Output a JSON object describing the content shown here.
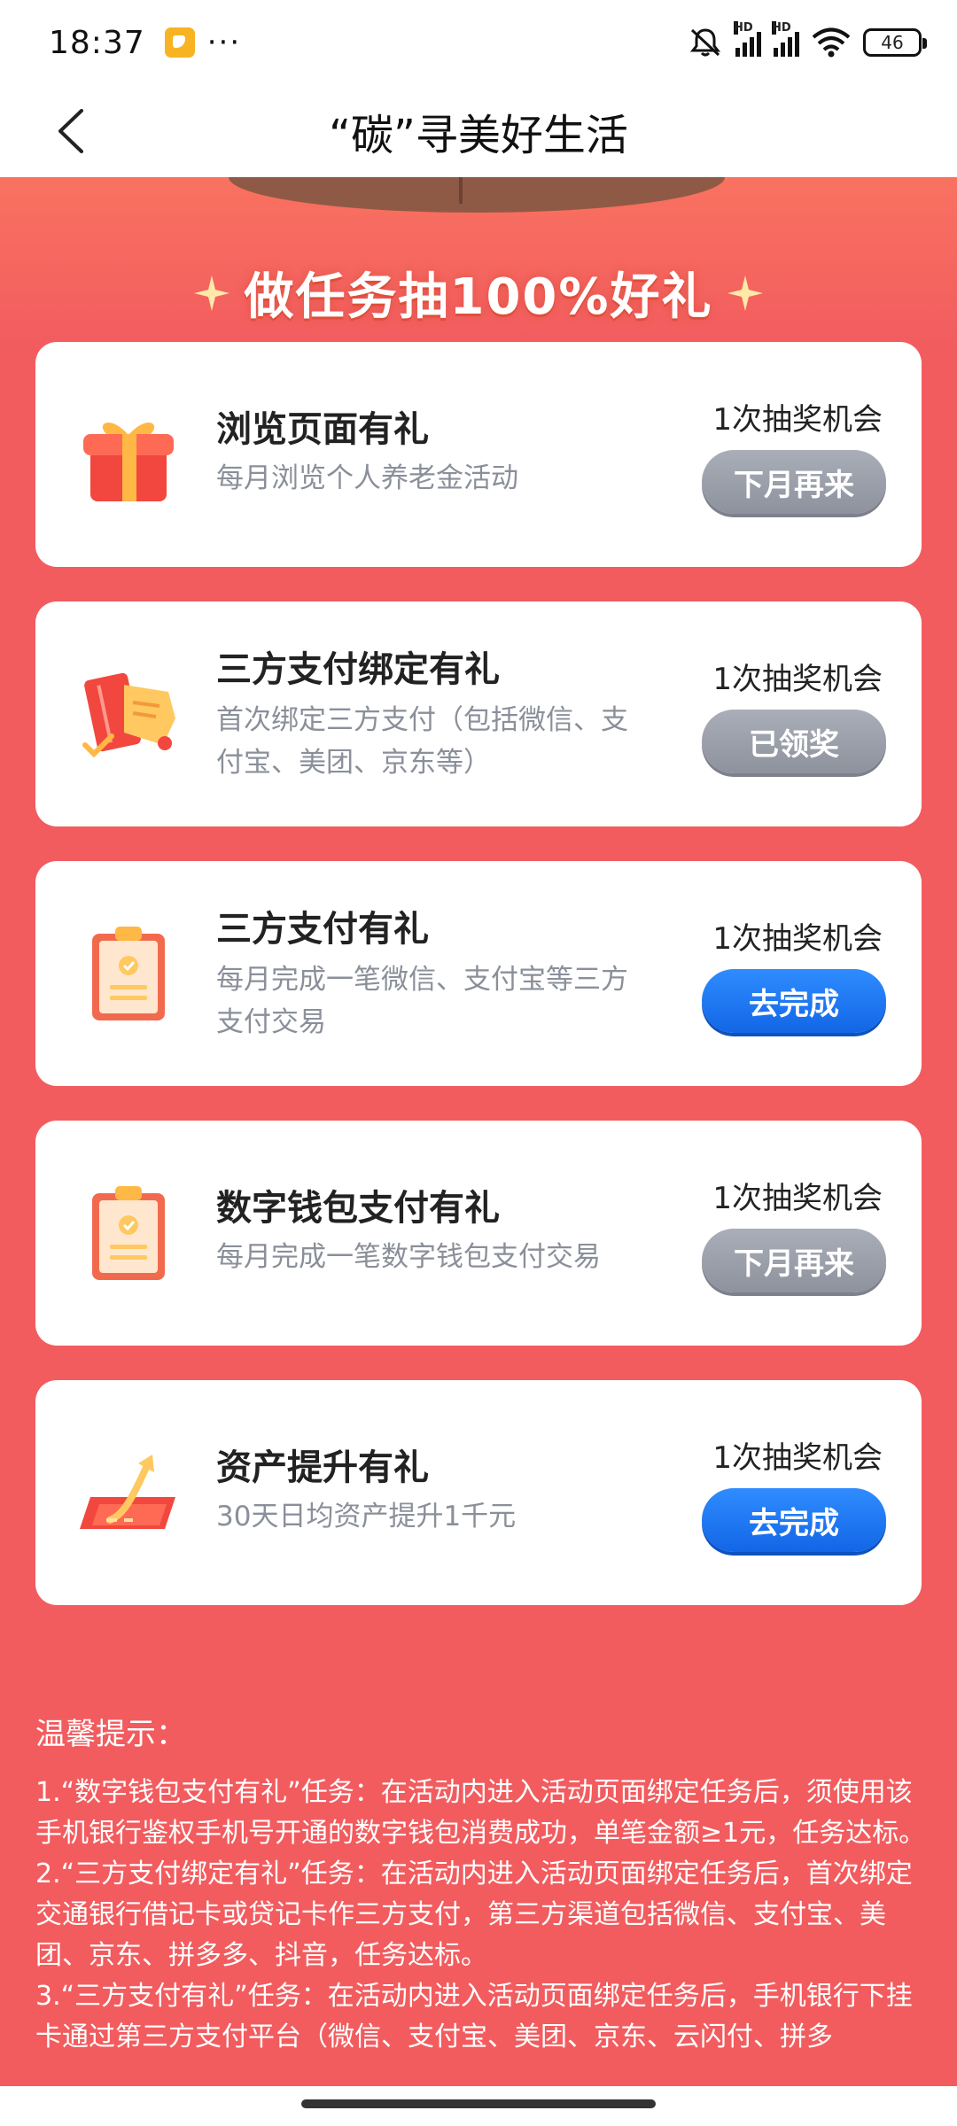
{
  "status_bar": {
    "time": "18:37",
    "dots": "···",
    "battery": "46"
  },
  "header": {
    "title": "“碳”寻美好生活"
  },
  "banner": {
    "title": "做任务抽100%好礼"
  },
  "tasks": [
    {
      "title": "浏览页面有礼",
      "desc": "每月浏览个人养老金活动",
      "chance": "1次抽奖机会",
      "button": "下月再来",
      "button_style": "gray",
      "icon": "gift-icon"
    },
    {
      "title": "三方支付绑定有礼",
      "desc": "首次绑定三方支付（包括微信、支付宝、美团、京东等）",
      "chance": "1次抽奖机会",
      "button": "已领奖",
      "button_style": "gray",
      "icon": "card-binding-icon"
    },
    {
      "title": "三方支付有礼",
      "desc": "每月完成一笔微信、支付宝等三方支付交易",
      "chance": "1次抽奖机会",
      "button": "去完成",
      "button_style": "blue",
      "icon": "clipboard-icon"
    },
    {
      "title": "数字钱包支付有礼",
      "desc": "每月完成一笔数字钱包支付交易",
      "chance": "1次抽奖机会",
      "button": "下月再来",
      "button_style": "gray",
      "icon": "clipboard-icon"
    },
    {
      "title": "资产提升有礼",
      "desc": "30天日均资产提升1千元",
      "chance": "1次抽奖机会",
      "button": "去完成",
      "button_style": "blue",
      "icon": "asset-growth-icon"
    }
  ],
  "tips": {
    "title": "温馨提示：",
    "items": [
      "1.“数字钱包支付有礼”任务：在活动内进入活动页面绑定任务后，须使用该手机银行鉴权手机号开通的数字钱包消费成功，单笔金额≥1元，任务达标。",
      "2.“三方支付绑定有礼”任务：在活动内进入活动页面绑定任务后，首次绑定交通银行借记卡或贷记卡作三方支付，第三方渠道包括微信、支付宝、美团、京东、拼多多、抖音，任务达标。",
      "3.“三方支付有礼”任务：在活动内进入活动页面绑定任务后，手机银行下挂卡通过第三方支付平台（微信、支付宝、美团、京东、云闪付、拼多"
    ]
  },
  "colors": {
    "background": "#F25C5F",
    "button_gray": "#8D929D",
    "button_blue": "#1266E6"
  }
}
